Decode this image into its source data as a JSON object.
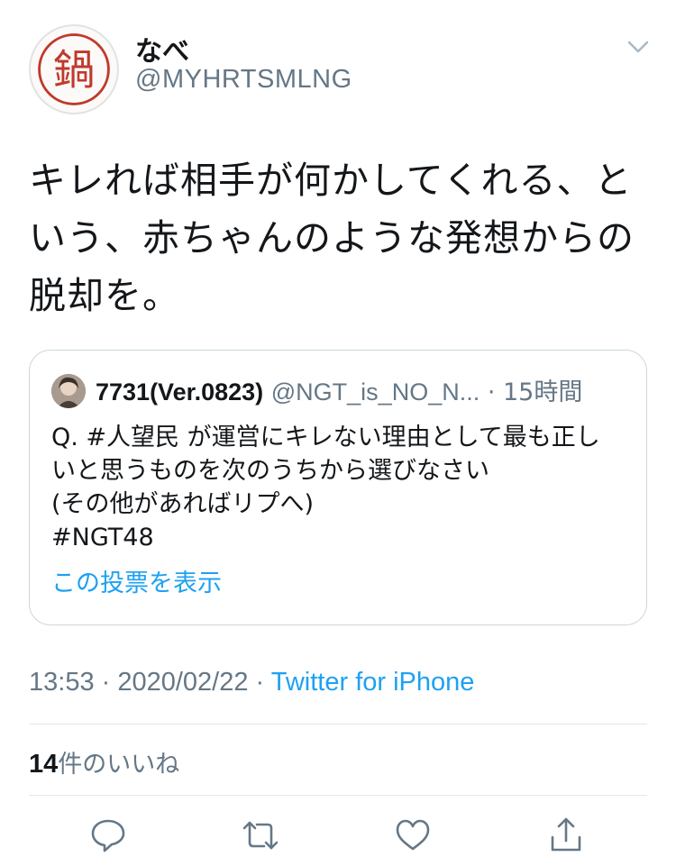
{
  "tweet": {
    "author_name": "なべ",
    "author_handle": "@MYHRTSMLNG",
    "avatar_kanji": "鍋",
    "text_lines": [
      "キレれば相手が何かしてくれる、と",
      "いう、赤ちゃんのような発想からの",
      "脱却を。"
    ],
    "timestamp": "13:53 · 2020/02/22 · ",
    "source": "Twitter for iPhone",
    "likes_count": "14",
    "likes_label": "件のいいね"
  },
  "quoted": {
    "name": "7731(Ver.0823)",
    "handle": "@NGT_is_NO_N...",
    "separator": " · ",
    "time": "15時間",
    "lines": [
      "Q. #人望民 が運営にキレない理由として最も正し",
      "いと思うものを次のうちから選びなさい",
      "(その他があればリプへ)",
      "#NGT48"
    ],
    "poll_link": "この投票を表示"
  },
  "icons": {
    "caret": "chevron-down-icon",
    "reply": "reply-icon",
    "retweet": "retweet-icon",
    "like": "heart-icon",
    "share": "share-icon"
  },
  "colors": {
    "text": "#14171a",
    "secondary": "#657786",
    "link": "#1da1f2",
    "border": "#ccd6dd",
    "avatar_red": "#c0392b"
  }
}
